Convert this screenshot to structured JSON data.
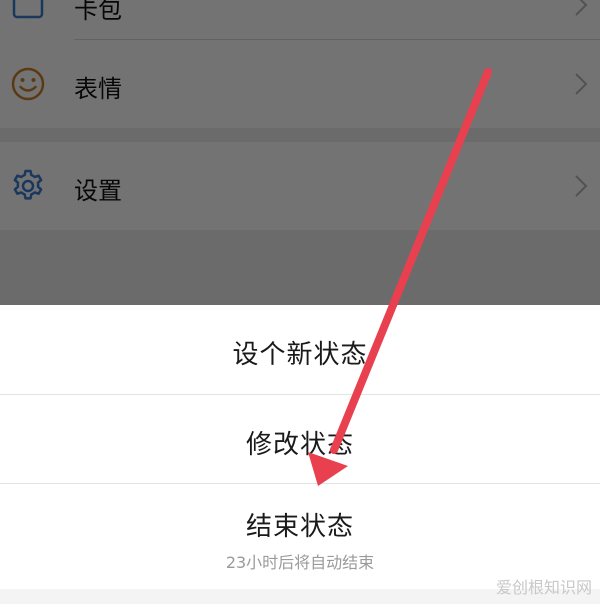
{
  "settings_list": {
    "items": [
      {
        "label": "卡包",
        "icon": "card-icon"
      },
      {
        "label": "表情",
        "icon": "smiley-icon"
      },
      {
        "label": "设置",
        "icon": "gear-icon"
      }
    ]
  },
  "action_sheet": {
    "items": [
      {
        "title": "设个新状态"
      },
      {
        "title": "修改状态"
      },
      {
        "title": "结束状态",
        "subtitle": "23小时后将自动结束"
      }
    ]
  },
  "annotation": {
    "arrow_color": "#e8404f"
  },
  "watermark": {
    "text": "爱创根知识网"
  },
  "colors": {
    "icon_orange": "#c9802b",
    "icon_blue": "#3b7bd1",
    "overlay": "rgba(0,0,0,0.55)"
  }
}
